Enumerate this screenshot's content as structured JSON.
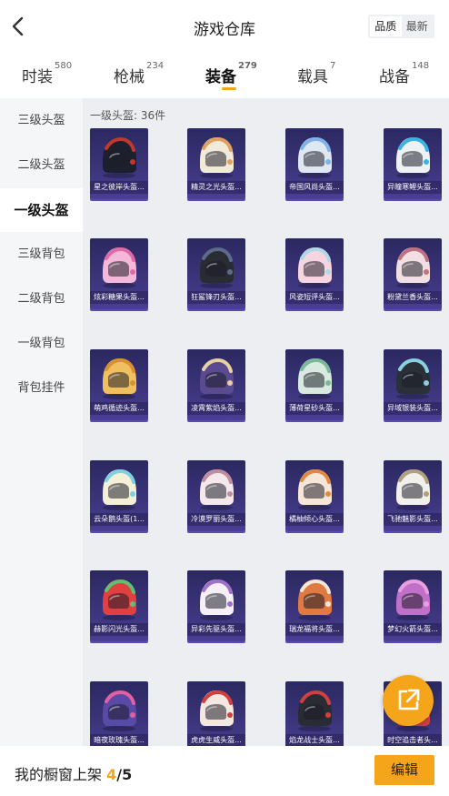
{
  "header": {
    "title": "游戏仓库",
    "sort_options": [
      "品质",
      "最新"
    ],
    "active_sort": "品质"
  },
  "tabs": [
    {
      "label": "时装",
      "count": "580"
    },
    {
      "label": "枪械",
      "count": "234"
    },
    {
      "label": "装备",
      "count": "279",
      "active": true
    },
    {
      "label": "载具",
      "count": "7"
    },
    {
      "label": "战备",
      "count": "148"
    }
  ],
  "sidebar": {
    "items": [
      {
        "label": "三级头盔"
      },
      {
        "label": "二级头盔"
      },
      {
        "label": "一级头盔",
        "active": true
      },
      {
        "label": "三级背包"
      },
      {
        "label": "二级背包"
      },
      {
        "label": "一级背包"
      },
      {
        "label": "背包挂件"
      }
    ]
  },
  "content": {
    "section_title": "一级头盔: 36件",
    "items": [
      {
        "name": "星之彼岸头盔...",
        "colors": [
          "#1c1f2e",
          "#c0392b"
        ]
      },
      {
        "name": "精灵之光头盔...",
        "colors": [
          "#f2ead8",
          "#e0a060"
        ]
      },
      {
        "name": "帝国风尚头盔...",
        "colors": [
          "#dfe8f2",
          "#7fb3e8"
        ]
      },
      {
        "name": "异瞳寒鲤头盔...",
        "colors": [
          "#eef2f5",
          "#3cb3e0"
        ]
      },
      {
        "name": "炫彩糖果头盔...",
        "colors": [
          "#f4b8d8",
          "#e06aa8"
        ]
      },
      {
        "name": "狂鲨锋刃头盔...",
        "colors": [
          "#2a2c33",
          "#5a6b8c"
        ]
      },
      {
        "name": "风姿短评头盔...",
        "colors": [
          "#f7d5e0",
          "#b0d8e8"
        ]
      },
      {
        "name": "粉黛兰香头盔...",
        "colors": [
          "#f2dfe3",
          "#c07080"
        ]
      },
      {
        "name": "萌鸡循迹头盔...",
        "colors": [
          "#f0c060",
          "#d89030"
        ]
      },
      {
        "name": "凌霄紫焰头盔...",
        "colors": [
          "#5a4a90",
          "#e8d0a0"
        ]
      },
      {
        "name": "薄荷星砂头盔...",
        "colors": [
          "#d8eadf",
          "#7ab89a"
        ]
      },
      {
        "name": "异域银装头盔...",
        "colors": [
          "#2a3038",
          "#8ad0e0"
        ]
      },
      {
        "name": "云朵鹅头盔(1...",
        "colors": [
          "#f4f0d8",
          "#7fd0e0"
        ]
      },
      {
        "name": "冷漠罗丽头盔...",
        "colors": [
          "#f4e8ec",
          "#c08ca0"
        ]
      },
      {
        "name": "橘柚倾心头盔...",
        "colors": [
          "#f6e6d8",
          "#e08a40"
        ]
      },
      {
        "name": "飞驰魅影头盔...",
        "colors": [
          "#f2f0ea",
          "#b0a080"
        ]
      },
      {
        "name": "赫影闪光头盔...",
        "colors": [
          "#e04040",
          "#60c070"
        ]
      },
      {
        "name": "异彩先驱头盔...",
        "colors": [
          "#f4f0f6",
          "#a070c8"
        ]
      },
      {
        "name": "瑞龙福将头盔...",
        "colors": [
          "#e07a40",
          "#f4e6d8"
        ]
      },
      {
        "name": "梦幻火箭头盔...",
        "colors": [
          "#c070c8",
          "#e8a0e0"
        ]
      },
      {
        "name": "暗夜玫瑰头盔...",
        "colors": [
          "#5a4aa8",
          "#e060a0"
        ]
      },
      {
        "name": "虎虎生威头盔...",
        "colors": [
          "#f4e6e0",
          "#d04040"
        ]
      },
      {
        "name": "焰龙战士头盔...",
        "colors": [
          "#2a2c33",
          "#d04040"
        ]
      },
      {
        "name": "时空追击者头...",
        "colors": [
          "#d04040",
          "#f2f0ea"
        ]
      }
    ]
  },
  "fab": {
    "icon": "share-external-icon"
  },
  "bottom": {
    "shelf_label": "我的橱窗上架",
    "shelf_current": "4",
    "shelf_sep": "/",
    "shelf_max": "5",
    "edit_label": "编辑"
  },
  "colors": {
    "accent": "#f5a51a",
    "card_bg": "#3b347a"
  }
}
